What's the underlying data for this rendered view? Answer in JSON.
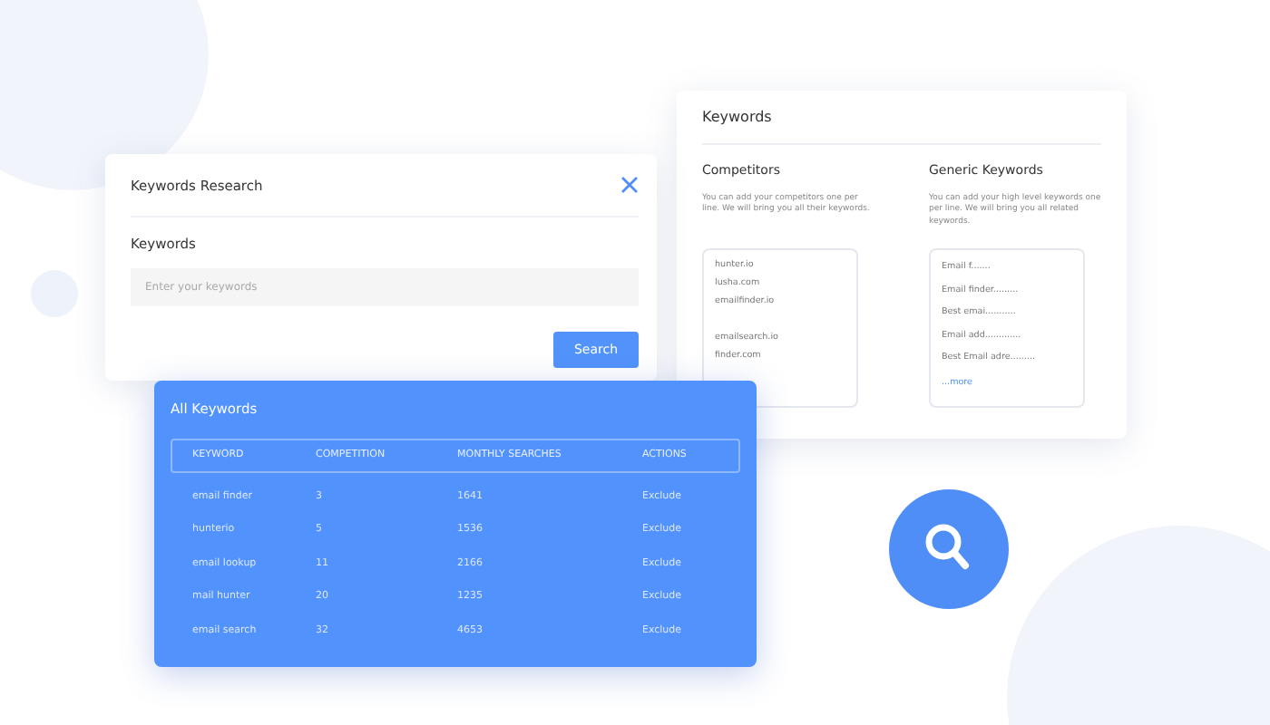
{
  "keywords_card": {
    "title": "Keywords",
    "competitors": {
      "heading": "Competitors",
      "hint": "You can add your competitors one per line. We will bring you all their keywords.",
      "groups": [
        [
          "hunter.io",
          "lusha.com",
          "emailfinder.io"
        ],
        [
          "emailsearch.io",
          "finder.com"
        ]
      ]
    },
    "generic": {
      "heading": "Generic Keywords",
      "hint": "You can add your high level keywords one per line. We will bring you all related keywords.",
      "groups": [
        [
          "Email f.......",
          "Email finder.........",
          "Best emai...........",
          "Email add.............",
          "Best Email adre........."
        ]
      ],
      "more": "...more"
    }
  },
  "research_dialog": {
    "title": "Keywords Research",
    "label": "Keywords",
    "placeholder": "Enter your keywords",
    "button": "Search"
  },
  "all_keywords": {
    "title": "All Keywords",
    "columns": [
      "KEYWORD",
      "COMPETITION",
      "MONTHLY SEARCHES",
      "ACTIONS"
    ],
    "rows": [
      [
        "email finder",
        "3",
        "1641",
        "Exclude"
      ],
      [
        "hunterio",
        "5",
        "1536",
        "Exclude"
      ],
      [
        "email lookup",
        "11",
        "2166",
        "Exclude"
      ],
      [
        "mail hunter",
        "20",
        "1235",
        "Exclude"
      ],
      [
        "email search",
        "32",
        "4653",
        "Exclude"
      ]
    ]
  }
}
